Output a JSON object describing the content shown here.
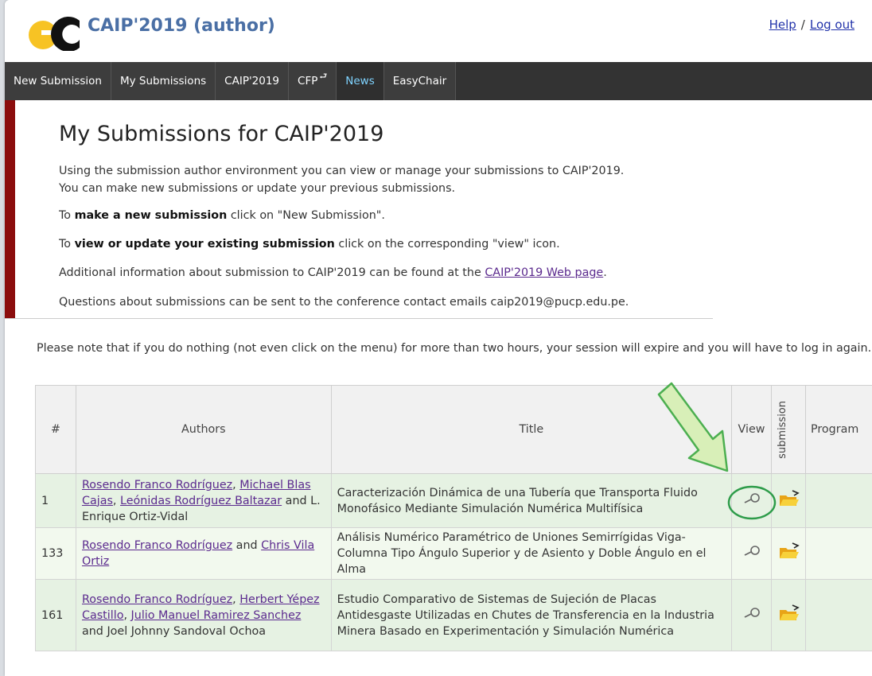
{
  "header": {
    "logo_text": "EC",
    "title": "CAIP'2019 (author)",
    "help_label": "Help",
    "separator": "/",
    "logout_label": "Log out"
  },
  "menu": {
    "items": [
      {
        "label": "New Submission"
      },
      {
        "label": "My Submissions"
      },
      {
        "label": "CAIP'2019"
      },
      {
        "label": "CFP"
      },
      {
        "label": "News"
      },
      {
        "label": "EasyChair"
      }
    ],
    "active": "News"
  },
  "intro": {
    "title": "My Submissions for CAIP'2019",
    "line1": "Using the submission author environment you can view or manage your submissions to CAIP'2019.",
    "line2": "You can make new submissions or update your previous submissions.",
    "make_prefix": "To ",
    "make_bold": "make a new submission",
    "make_suffix": " click on \"New Submission\".",
    "update_prefix": "To ",
    "update_bold": "view or update your existing submission",
    "update_suffix": " click on the corresponding \"view\" icon.",
    "additional_prefix": "Additional information about submission to CAIP'2019 can be found at the ",
    "additional_link": "CAIP'2019 Web page",
    "additional_suffix": ".",
    "questions": "Questions about submissions can be sent to the conference contact emails caip2019@pucp.edu.pe."
  },
  "note": "Please note that if you do nothing (not even click on the menu) for more than two hours, your session will expire and you will have to log in again.",
  "table": {
    "headers": {
      "num": "#",
      "authors": "Authors",
      "title": "Title",
      "view": "View",
      "submission": "submission",
      "program": "Program"
    },
    "rows": [
      {
        "num": "1",
        "authors_linked": [
          "Rosendo Franco Rodríguez",
          "Michael Blas Cajas",
          "Leónidas Rodríguez Baltazar"
        ],
        "authors_plain": "L. Enrique Ortiz-Vidal",
        "title": "Caracterización Dinámica de una Tubería que Transporta Fluido Monofásico Mediante Simulación Numérica Multifísica"
      },
      {
        "num": "133",
        "authors_linked": [
          "Rosendo Franco Rodríguez",
          "Chris Vila Ortiz"
        ],
        "authors_plain": "",
        "title": "Análisis Numérico Paramétrico de Uniones Semirrígidas Viga-Columna Tipo Ángulo Superior y de Asiento y Doble Ángulo en el Alma"
      },
      {
        "num": "161",
        "authors_linked": [
          "Rosendo Franco Rodríguez",
          "Herbert Yépez Castillo",
          "Julio Manuel Ramirez Sanchez"
        ],
        "authors_plain": "Joel Johnny Sandoval Ochoa",
        "title": "Estudio Comparativo de Sistemas de Sujeción de Placas Antidesgaste Utilizadas en Chutes de Transferencia en la Industria Minera Basado en Experimentación y Simulación Numérica"
      }
    ]
  },
  "colors": {
    "accent_title": "#4a6fa5",
    "menu_bg": "#333333",
    "red_bar": "#8b0d0d",
    "annotation_green": "#4caf50",
    "arrow_fill": "#d8efb8"
  }
}
